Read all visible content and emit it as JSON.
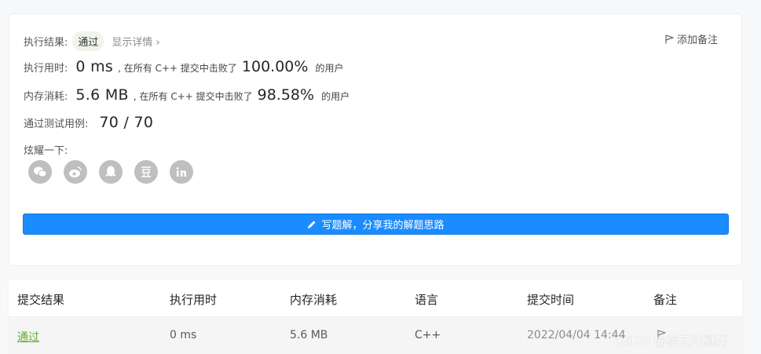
{
  "result": {
    "label": "执行结果:",
    "status": "通过",
    "detail": "显示详情 ›",
    "note_button": "添加备注"
  },
  "runtime": {
    "label": "执行用时:",
    "value": "0 ms",
    "prefix": ", 在所有 C++ 提交中击败了",
    "percent": "100.00%",
    "suffix": "的用户"
  },
  "memory": {
    "label": "内存消耗:",
    "value": "5.6 MB",
    "prefix": ", 在所有 C++ 提交中击败了",
    "percent": "98.58%",
    "suffix": "的用户"
  },
  "tests": {
    "label": "通过测试用例:",
    "value": "70 / 70"
  },
  "share": {
    "label": "炫耀一下:",
    "icons": [
      "wechat-icon",
      "weibo-icon",
      "qq-icon",
      "douban-icon",
      "linkedin-icon"
    ]
  },
  "write_button": "写题解，分享我的解题思路",
  "table": {
    "headers": [
      "提交结果",
      "执行用时",
      "内存消耗",
      "语言",
      "提交时间",
      "备注"
    ],
    "row": [
      "通过",
      "0 ms",
      "5.6 MB",
      "C++",
      "2022/04/04 14:44"
    ]
  },
  "watermark": "CSDN @桂花年糕仔",
  "colors": {
    "accent": "#1a8cff",
    "success": "#5cb030"
  }
}
